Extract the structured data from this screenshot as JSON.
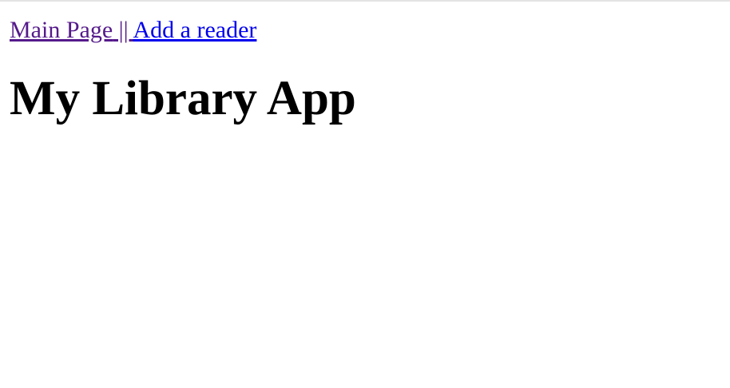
{
  "nav": {
    "main_page_label": "Main Page",
    "separator": " || ",
    "add_reader_label": "Add a reader"
  },
  "page": {
    "title": "My Library App"
  },
  "colors": {
    "visited_link": "#551a8b",
    "link": "#0000ee"
  }
}
